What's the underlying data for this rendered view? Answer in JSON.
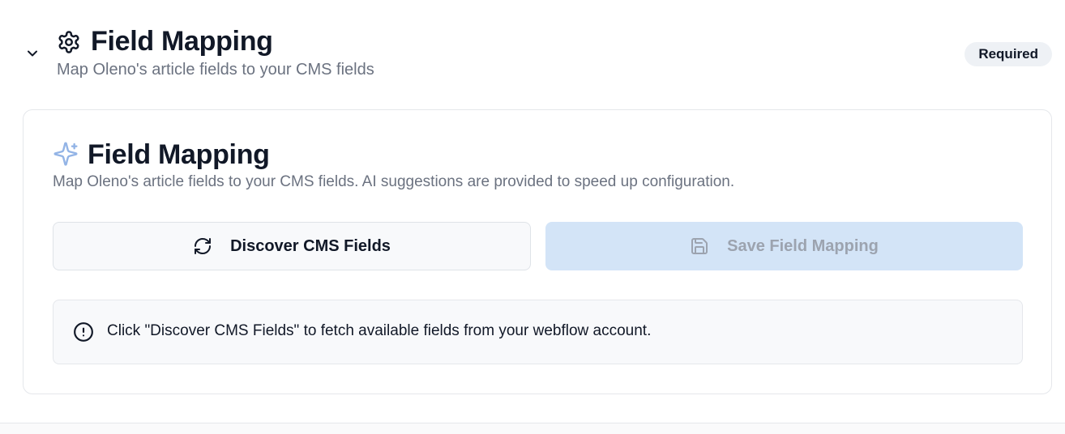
{
  "section": {
    "title": "Field Mapping",
    "subtitle": "Map Oleno's article fields to your CMS fields",
    "badge": "Required",
    "icons": {
      "toggle": "chevron-down-icon",
      "header": "gear-icon"
    }
  },
  "card": {
    "title": "Field Mapping",
    "description": "Map Oleno's article fields to your CMS fields. AI suggestions are provided to speed up configuration.",
    "icon": "sparkles-icon",
    "buttons": {
      "discover": {
        "label": "Discover CMS Fields",
        "icon": "refresh-icon"
      },
      "save": {
        "label": "Save Field Mapping",
        "icon": "save-icon",
        "disabled": true
      }
    },
    "alert": {
      "text": "Click \"Discover CMS Fields\" to fetch available fields from your webflow account.",
      "icon": "info-circle-icon"
    }
  },
  "colors": {
    "accent_light": "#d3e4f7",
    "sparkle": "#93b4e6",
    "muted_text": "#6b7280",
    "badge_bg": "#eef1f5"
  }
}
